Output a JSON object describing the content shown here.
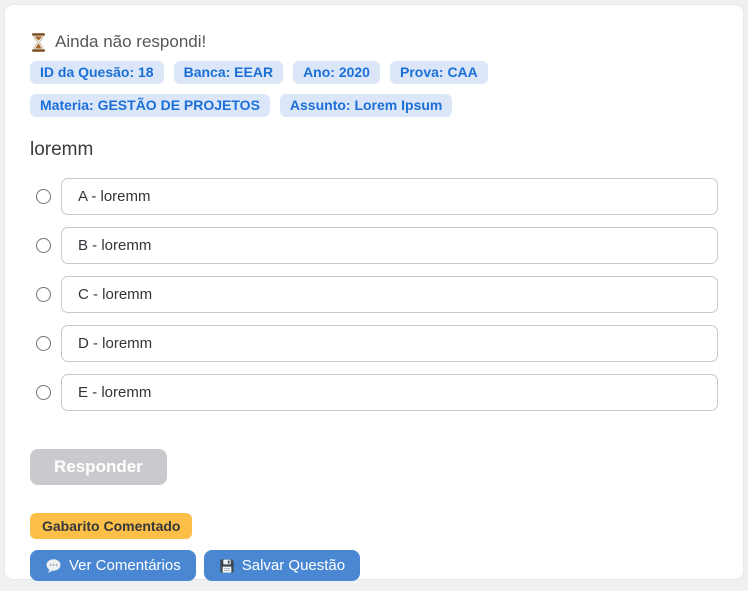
{
  "status": {
    "icon": "hourglass",
    "text": "Ainda não respondi!"
  },
  "badges": [
    {
      "text": "ID da Quesão: 18"
    },
    {
      "text": "Banca: EEAR"
    },
    {
      "text": "Ano: 2020"
    },
    {
      "text": "Prova: CAA"
    },
    {
      "text": "Materia: GESTÃO DE PROJETOS"
    },
    {
      "text": "Assunto: Lorem Ipsum"
    }
  ],
  "question": {
    "text": "loremm"
  },
  "options": [
    {
      "letter": "A",
      "label": "A - loremm",
      "selected": false
    },
    {
      "letter": "B",
      "label": "B - loremm",
      "selected": false
    },
    {
      "letter": "C",
      "label": "C - loremm",
      "selected": false
    },
    {
      "letter": "D",
      "label": "D - loremm",
      "selected": false
    },
    {
      "letter": "E",
      "label": "E - loremm",
      "selected": false
    }
  ],
  "actions": {
    "responder": "Responder",
    "responder_enabled": false,
    "gabarito": "Gabarito Comentado",
    "ver_comentarios": "Ver Comentários",
    "ver_comentarios_icon": "speech-bubble",
    "salvar_questao": "Salvar Questão",
    "salvar_questao_icon": "floppy-disk"
  },
  "colors": {
    "page_bg": "#eef0f2",
    "card_bg": "#ffffff",
    "badge_bg": "#dbe7f9",
    "badge_text": "#1b6fd6",
    "primary_button": "#4a87d2",
    "disabled_button": "#c8cacd",
    "gabarito_bg": "#fcbf47",
    "option_border": "#c6cacd"
  }
}
